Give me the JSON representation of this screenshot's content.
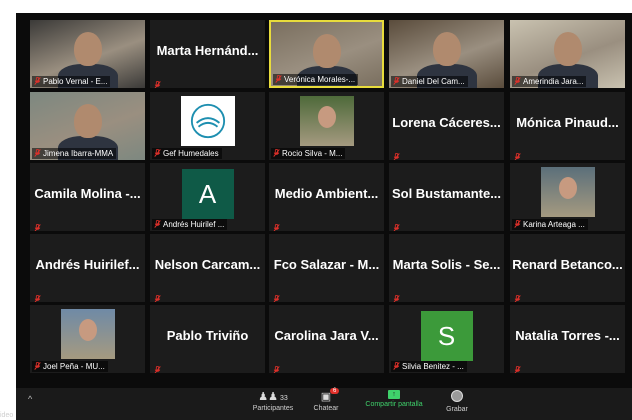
{
  "tiles": [
    {
      "name": "Pablo Vernal - E...",
      "type": "video",
      "bg": "#3b3a38"
    },
    {
      "name": "Marta Hernánd...",
      "type": "name"
    },
    {
      "name": "Verónica Morales-...",
      "type": "video",
      "bg": "#7a6f5f",
      "active": true
    },
    {
      "name": "Daniel Del Cam...",
      "type": "video",
      "bg": "#5a4c3c"
    },
    {
      "name": "Amerindia Jara...",
      "type": "video",
      "bg": "#c9c2b0"
    },
    {
      "name": "Jimena Ibarra-MMA",
      "type": "video",
      "bg": "#7d8880"
    },
    {
      "name": "Gef Humedales",
      "type": "logo"
    },
    {
      "name": "Rocio Silva - M...",
      "type": "photo",
      "bg": "#4e6a3a"
    },
    {
      "name": "Lorena Cáceres...",
      "type": "name"
    },
    {
      "name": "Mónica Pinaud...",
      "type": "name"
    },
    {
      "name": "Camila Molina -...",
      "type": "name"
    },
    {
      "name": "Andrés Huirilef ...",
      "type": "letter",
      "letter": "A",
      "letter_bg": "#0f5a47"
    },
    {
      "name": "Medio Ambient...",
      "type": "name"
    },
    {
      "name": "Sol Bustamante...",
      "type": "name"
    },
    {
      "name": "Karina Arteaga ...",
      "type": "photo",
      "bg": "#5b6f7a"
    },
    {
      "name": "Andrés Huirilef...",
      "type": "name"
    },
    {
      "name": "Nelson Carcam...",
      "type": "name"
    },
    {
      "name": "Fco Salazar - M...",
      "type": "name"
    },
    {
      "name": "Marta Solis - Se...",
      "type": "name"
    },
    {
      "name": "Renard Betanco...",
      "type": "name"
    },
    {
      "name": "Joel Peña - MU...",
      "type": "photo",
      "bg": "#6f8aa6"
    },
    {
      "name": "Pablo Triviño",
      "type": "name"
    },
    {
      "name": "Carolina Jara V...",
      "type": "name"
    },
    {
      "name": "Silvia Benitez - ...",
      "type": "letter",
      "letter": "S",
      "letter_bg": "#3c9a3a"
    },
    {
      "name": "Natalia Torres -...",
      "type": "name"
    }
  ],
  "toolbar": {
    "video_label": "ideo",
    "participants_label": "Participantes",
    "participants_count": "33",
    "chat_label": "Chatear",
    "chat_badge": "6",
    "share_label": "Compartir pantalla",
    "record_label": "Grabar"
  },
  "colors": {
    "active_border": "#e8dc3c",
    "muted_mic": "#e0302a",
    "share_green": "#3fd16b",
    "chat_badge": "#e0302a"
  }
}
